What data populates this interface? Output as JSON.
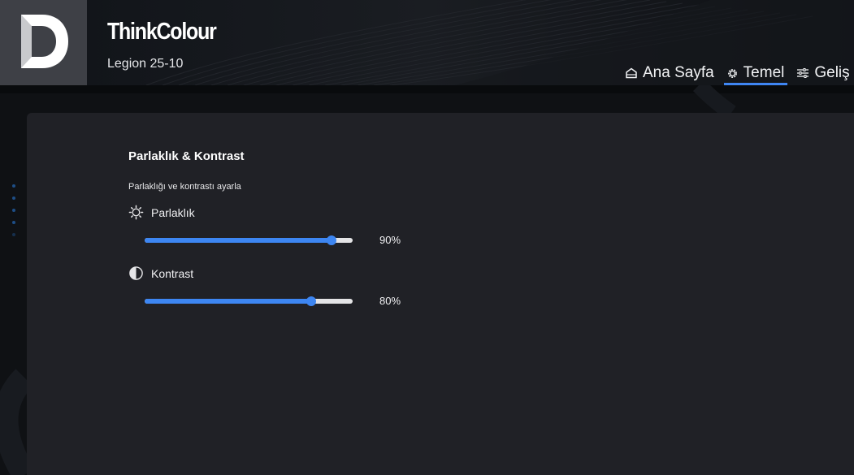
{
  "header": {
    "brand": "ThinkColour",
    "device_name": "Legion 25-10",
    "nav": [
      {
        "label": "Ana Sayfa",
        "icon": "home-icon",
        "active": false
      },
      {
        "label": "Temel",
        "icon": "gear-icon",
        "active": true
      },
      {
        "label": "Geliş",
        "icon": "sliders-icon",
        "active": false
      }
    ]
  },
  "panel": {
    "title": "Parlaklık & Kontrast",
    "description": "Parlaklığı ve kontrastı ayarla",
    "brightness": {
      "label": "Parlaklık",
      "icon": "sun-icon",
      "value_text": "90%",
      "level": 0.9
    },
    "contrast": {
      "label": "Kontrast",
      "icon": "contrast-icon",
      "value_text": "80%",
      "level": 0.8
    }
  },
  "colors": {
    "accent": "#3d86f2",
    "brand_red": "#e2231a",
    "panel_bg": "#202126",
    "header_bg": "#0b0d10"
  }
}
